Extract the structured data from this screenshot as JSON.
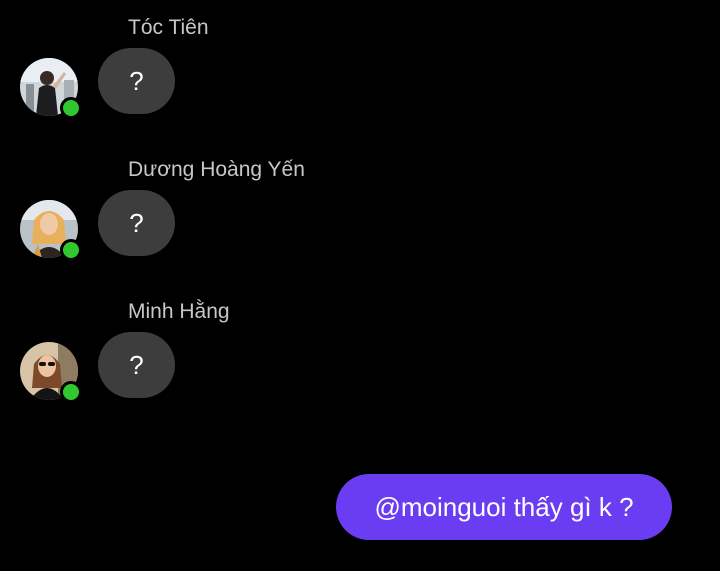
{
  "messages": [
    {
      "sender": "Tóc Tiên",
      "text": "?",
      "online": true,
      "avatar_icon": "profile-photo-woman-icon"
    },
    {
      "sender": "Dương Hoàng Yến",
      "text": "?",
      "online": true,
      "avatar_icon": "profile-photo-woman-blonde-icon"
    },
    {
      "sender": "Minh Hằng",
      "text": "?",
      "online": true,
      "avatar_icon": "profile-photo-woman-sunglasses-icon"
    }
  ],
  "outgoing": {
    "text": "@moinguoi thấy gì k ?"
  },
  "colors": {
    "background": "#000000",
    "incoming_bubble": "#3d3d3d",
    "outgoing_bubble": "#6a3df3",
    "online_dot": "#31c82f",
    "sender_name": "#c7c7c7"
  }
}
